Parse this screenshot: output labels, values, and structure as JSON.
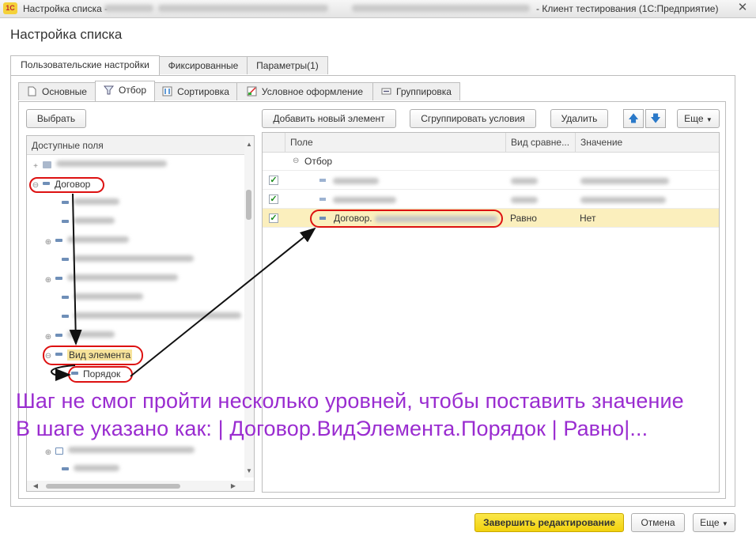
{
  "window": {
    "icon": "1С",
    "title_prefix": "Настройка списка -",
    "title_suffix": "- Клиент тестирования (1С:Предприятие)",
    "close_icon": "close-icon"
  },
  "heading": "Настройка списка",
  "top_tabs": [
    "Пользовательские настройки",
    "Фиксированные",
    "Параметры(1)"
  ],
  "sub_tabs": [
    "Основные",
    "Отбор",
    "Сортировка",
    "Условное оформление",
    "Группировка"
  ],
  "left": {
    "select_button": "Выбрать",
    "header": "Доступные поля",
    "nodes": {
      "dogovor": "Договор",
      "vid_elementa": "Вид элемента",
      "poryadok": "Порядок"
    }
  },
  "toolbar": {
    "add_element": "Добавить новый элемент",
    "group_conditions": "Сгруппировать условия",
    "delete": "Удалить",
    "more": "Еще"
  },
  "grid": {
    "columns": [
      "Поле",
      "Вид сравне...",
      "Значение"
    ],
    "group_label": "Отбор",
    "selected_row": {
      "field": "Договор.",
      "comparison": "Равно",
      "value": "Нет"
    }
  },
  "overlay": {
    "line1": "Шаг не смог пройти несколько уровней, чтобы поставить значение",
    "line2": "В шаге указано как: | Договор.ВидЭлемента.Порядок | Равно|..."
  },
  "footer": {
    "finish": "Завершить редактирование",
    "cancel": "Отмена",
    "more": "Еще"
  },
  "colors": {
    "accent_yellow": "#f2d20e",
    "annotation_red": "#dd1111",
    "overlay_purple": "#9a2cd0",
    "selection": "#fbefbd"
  }
}
